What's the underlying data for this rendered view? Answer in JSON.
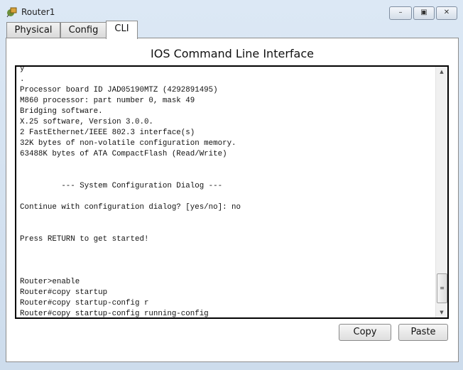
{
  "window": {
    "title": "Router1",
    "icon": "router-app-icon",
    "controls": {
      "minimize": "–",
      "maximize": "▣",
      "close": "✕"
    }
  },
  "tabs": [
    {
      "label": "Physical"
    },
    {
      "label": "Config"
    },
    {
      "label": "CLI",
      "active": true
    }
  ],
  "panel": {
    "heading": "IOS Command Line Interface"
  },
  "terminal": {
    "lines": [
      "y",
      ".",
      "Processor board ID JAD05190MTZ (4292891495)",
      "M860 processor: part number 0, mask 49",
      "Bridging software.",
      "X.25 software, Version 3.0.0.",
      "2 FastEthernet/IEEE 802.3 interface(s)",
      "32K bytes of non-volatile configuration memory.",
      "63488K bytes of ATA CompactFlash (Read/Write)",
      "",
      "",
      "         --- System Configuration Dialog ---",
      "",
      "Continue with configuration dialog? [yes/no]: no",
      "",
      "",
      "Press RETURN to get started!",
      "",
      "",
      "",
      "Router>enable",
      "Router#copy startup",
      "Router#copy startup-config r",
      "Router#copy startup-config running-config"
    ]
  },
  "buttons": {
    "copy": "Copy",
    "paste": "Paste"
  }
}
